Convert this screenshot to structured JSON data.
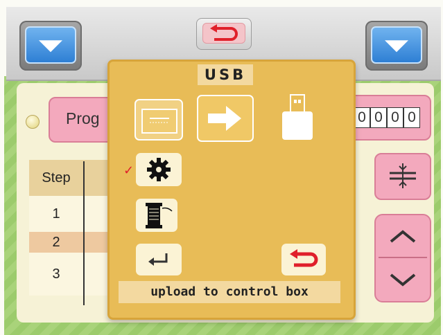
{
  "top_bar": {
    "left_button_icon": "triangle-down-icon",
    "center_button_icon": "return-arrow-icon",
    "right_button_icon": "triangle-down-icon"
  },
  "program": {
    "label": "Prog",
    "counter_digits": [
      "0",
      "0",
      "0",
      "0"
    ]
  },
  "table": {
    "header": "Step",
    "rows": [
      "1",
      "2",
      "3"
    ]
  },
  "right_controls": {
    "align_icon": "center-align-icon",
    "up_icon": "chevron-up-icon",
    "down_icon": "chevron-down-icon"
  },
  "dialog": {
    "title": "USB",
    "icons": [
      "control-panel-icon",
      "arrow-right-icon",
      "usb-drive-icon",
      "gear-icon",
      "thread-spool-icon",
      "enter-icon",
      "return-arrow-icon"
    ],
    "selected_marker": "✓",
    "status_text": "upload to control box"
  },
  "colors": {
    "accent_pink": "#f3a9bd",
    "dialog_gold": "#e8bc57",
    "button_blue": "#2e7fd4",
    "return_red": "#e0202a"
  }
}
